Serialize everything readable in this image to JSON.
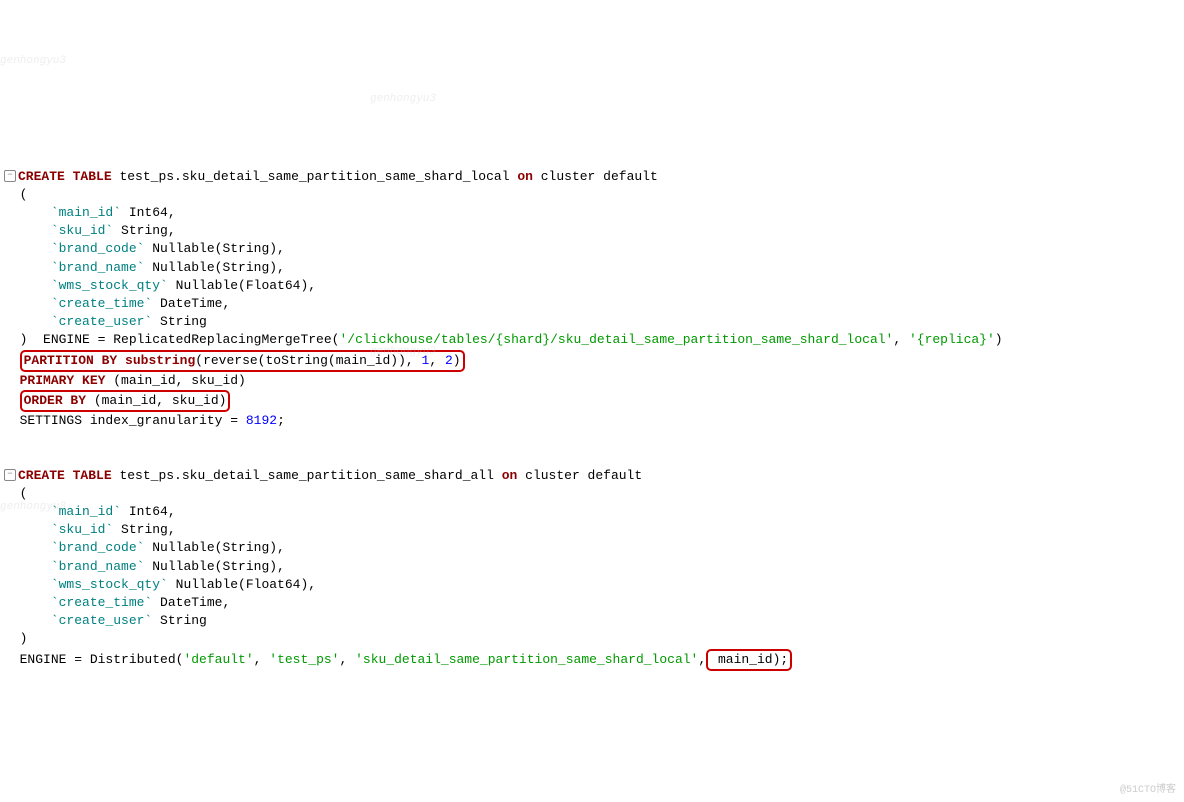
{
  "block1": {
    "create": "CREATE TABLE",
    "table_name": "test_ps.sku_detail_same_partition_same_shard_local",
    "on": "on",
    "cluster": "cluster default",
    "open_paren": "(",
    "cols": {
      "main_id_name": "`main_id`",
      "main_id_type": " Int64,",
      "sku_id_name": "`sku_id`",
      "sku_id_type": " String,",
      "brand_code_name": "`brand_code`",
      "brand_code_type": " Nullable(String),",
      "brand_name_name": "`brand_name`",
      "brand_name_type": " Nullable(String),",
      "wms_name": "`wms_stock_qty`",
      "wms_type": " Nullable(Float64),",
      "create_time_name": "`create_time`",
      "create_time_type": " DateTime,",
      "create_user_name": "`create_user`",
      "create_user_type": " String"
    },
    "engine_prefix": ")  ENGINE = ReplicatedReplacingMergeTree(",
    "engine_path": "'/clickhouse/tables/{shard}/sku_detail_same_partition_same_shard_local'",
    "engine_comma": ", ",
    "engine_replica": "'{replica}'",
    "engine_close": ")",
    "partition_kw": "PARTITION BY",
    "substring_kw": "substring",
    "partition_args1": "(reverse(toString(main_id)), ",
    "n1": "1",
    "comma_sep": ", ",
    "n2": "2",
    "partition_close": ")",
    "primary_kw": "PRIMARY KEY",
    "primary_args": " (main_id, sku_id)",
    "order_kw": "ORDER BY",
    "order_args": " (main_id, sku_id)",
    "settings_prefix": "SETTINGS index_granularity = ",
    "settings_val": "8192",
    "semicolon": ";"
  },
  "block2": {
    "create": "CREATE TABLE",
    "table_name": "test_ps.sku_detail_same_partition_same_shard_all",
    "on": "on",
    "cluster": "cluster default",
    "open_paren": "(",
    "cols": {
      "main_id_name": "`main_id`",
      "main_id_type": " Int64,",
      "sku_id_name": "`sku_id`",
      "sku_id_type": " String,",
      "brand_code_name": "`brand_code`",
      "brand_code_type": " Nullable(String),",
      "brand_name_name": "`brand_name`",
      "brand_name_type": " Nullable(String),",
      "wms_name": "`wms_stock_qty`",
      "wms_type": " Nullable(Float64),",
      "create_time_name": "`create_time`",
      "create_time_type": " DateTime,",
      "create_user_name": "`create_user`",
      "create_user_type": " String"
    },
    "close_paren": ")",
    "engine_prefix": "ENGINE = Distributed(",
    "arg_default": "'default'",
    "arg_testps": "'test_ps'",
    "arg_table": "'sku_detail_same_partition_same_shard_local'",
    "engine_postbox": " main_id);"
  },
  "watermarks": {
    "w1": "genhongyu3",
    "w2": "genhongyu3",
    "w3": "genhongyu3",
    "w4": "genhongyu3"
  },
  "credit": "@51CTO博客",
  "collapse_glyph": "−"
}
